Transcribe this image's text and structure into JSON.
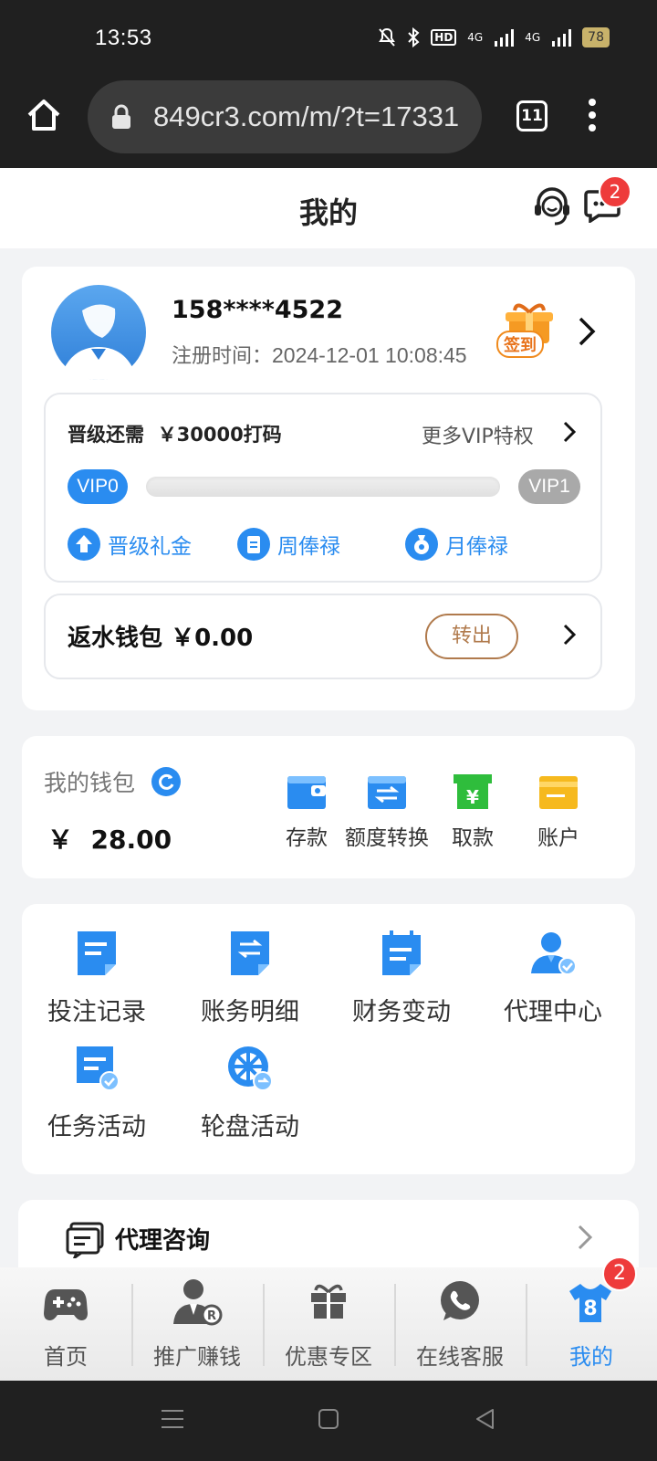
{
  "status": {
    "time": "13:53",
    "battery": "78",
    "net1": "4G",
    "net2": "4G"
  },
  "browser": {
    "url": "849cr3.com/m/?t=17331",
    "tabs": "11"
  },
  "header": {
    "title": "我的",
    "msg_badge": "2"
  },
  "profile": {
    "username": "158****4522",
    "reg_label": "注册时间：",
    "reg_time": "2024-12-01 10:08:45",
    "signin": "签到"
  },
  "vip": {
    "need_label": "晋级还需",
    "need_value": "￥30000打码",
    "more": "更多VIP特权",
    "from": "VIP0",
    "to": "VIP1",
    "progress": 0,
    "perks": [
      "晋级礼金",
      "周俸禄",
      "月俸禄"
    ]
  },
  "rebate": {
    "label": "返水钱包",
    "value": "￥0.00",
    "button": "转出"
  },
  "wallet": {
    "title": "我的钱包",
    "currency": "￥",
    "balance": "28.00",
    "actions": [
      "存款",
      "额度转换",
      "取款",
      "账户"
    ]
  },
  "menu": [
    "投注记录",
    "账务明细",
    "财务变动",
    "代理中心",
    "任务活动",
    "轮盘活动"
  ],
  "agent": {
    "title": "代理咨询"
  },
  "tabbar": {
    "items": [
      "首页",
      "推广赚钱",
      "优惠专区",
      "在线客服",
      "我的"
    ],
    "badge": "2",
    "active_color": "#2a8cf0"
  },
  "colors": {
    "accent": "#2a8cf0",
    "badge": "#ee3b3b",
    "green": "#2fbd3c",
    "gold": "#f6b91e"
  }
}
